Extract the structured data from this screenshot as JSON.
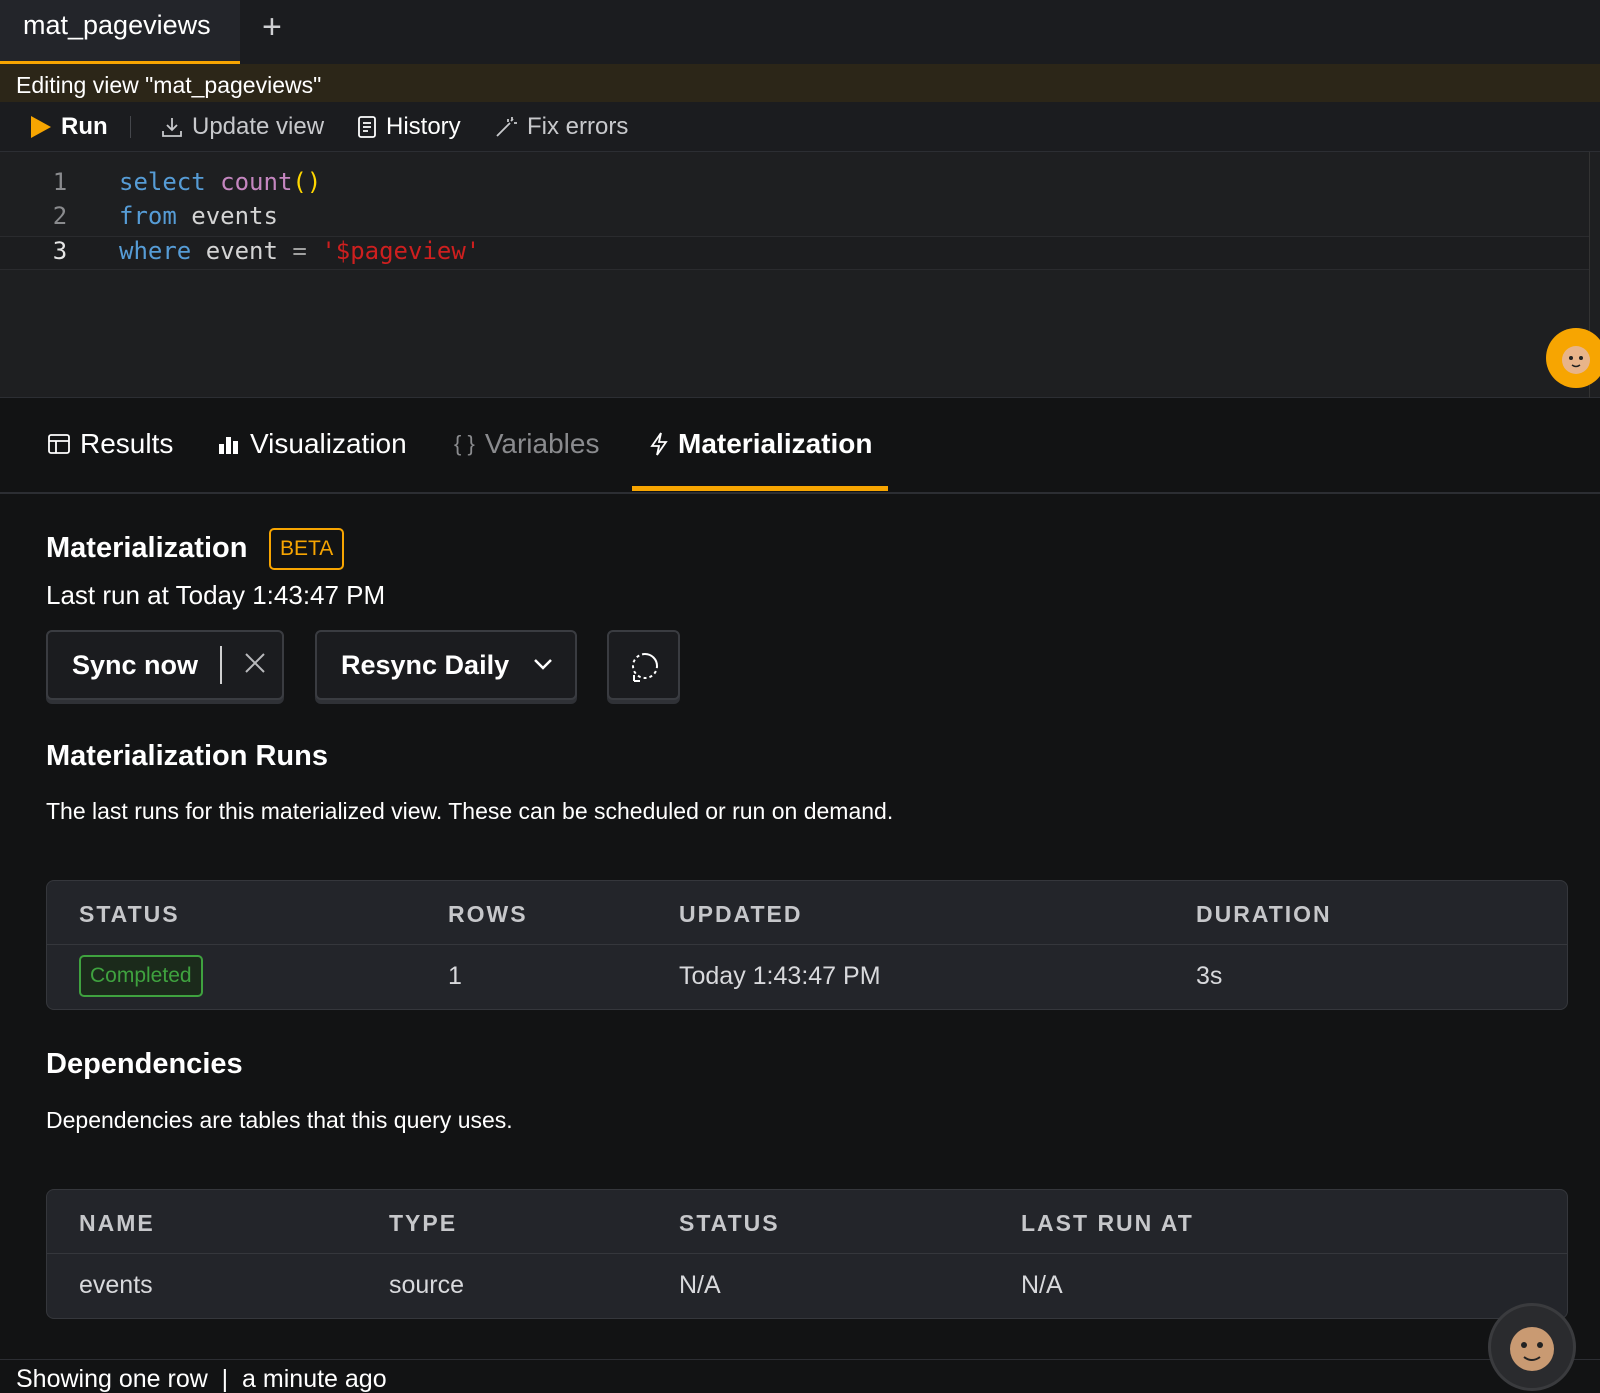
{
  "tab": {
    "title": "mat_pageviews",
    "add_icon": "+"
  },
  "banner": {
    "text": "Editing view \"mat_pageviews\""
  },
  "toolbar": {
    "run_label": "Run",
    "update_label": "Update view",
    "history_label": "History",
    "fix_label": "Fix errors",
    "run_color": "#f7a501"
  },
  "editor": {
    "lines": [
      {
        "num": "1",
        "tokens": [
          "select",
          "count",
          "()"
        ]
      },
      {
        "num": "2",
        "tokens": [
          "from",
          "events"
        ]
      },
      {
        "num": "3",
        "tokens": [
          "where",
          "event",
          "=",
          "'$pageview'"
        ]
      }
    ]
  },
  "result_tabs": {
    "results": "Results",
    "visualization": "Visualization",
    "variables": "Variables",
    "materialization": "Materialization",
    "active": "materialization"
  },
  "materialization": {
    "title": "Materialization",
    "beta": "BETA",
    "last_run": "Last run at Today 1:43:47 PM",
    "sync_label": "Sync now",
    "resync_label": "Resync Daily"
  },
  "runs": {
    "title": "Materialization Runs",
    "description": "The last runs for this materialized view. These can be scheduled or run on demand.",
    "headers": [
      "STATUS",
      "ROWS",
      "UPDATED",
      "DURATION"
    ],
    "rows": [
      {
        "status": "Completed",
        "rows": "1",
        "updated": "Today 1:43:47 PM",
        "duration": "3s"
      }
    ]
  },
  "dependencies": {
    "title": "Dependencies",
    "description": "Dependencies are tables that this query uses.",
    "headers": [
      "NAME",
      "TYPE",
      "STATUS",
      "LAST RUN AT"
    ],
    "rows": [
      {
        "name": "events",
        "type": "source",
        "status": "N/A",
        "last_run": "N/A"
      }
    ]
  },
  "statusbar": {
    "text": "Showing one row  |  a minute ago"
  },
  "colors": {
    "accent": "#f7a501",
    "success": "#3fa23f",
    "background": "#121314"
  }
}
